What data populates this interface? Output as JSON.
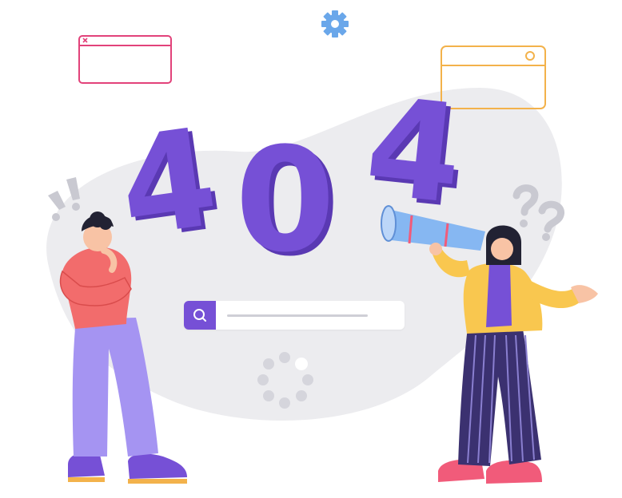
{
  "illustration": {
    "error_code": "404",
    "icons": [
      "gear-icon",
      "window-icon",
      "search-icon",
      "spinner-icon"
    ],
    "colors": {
      "purple": "#7650d6",
      "purple_dark": "#5a39b3",
      "blob": "#ececef",
      "pink_window": "#e2427a",
      "orange_window": "#f3b24b",
      "gear": "#6aa7ea",
      "telescope": "#86b7f2",
      "pants_left": "#a594f2",
      "shirt_left": "#f26c6c",
      "jacket_right": "#f9c74f",
      "shoes_right": "#f15b7a"
    }
  }
}
